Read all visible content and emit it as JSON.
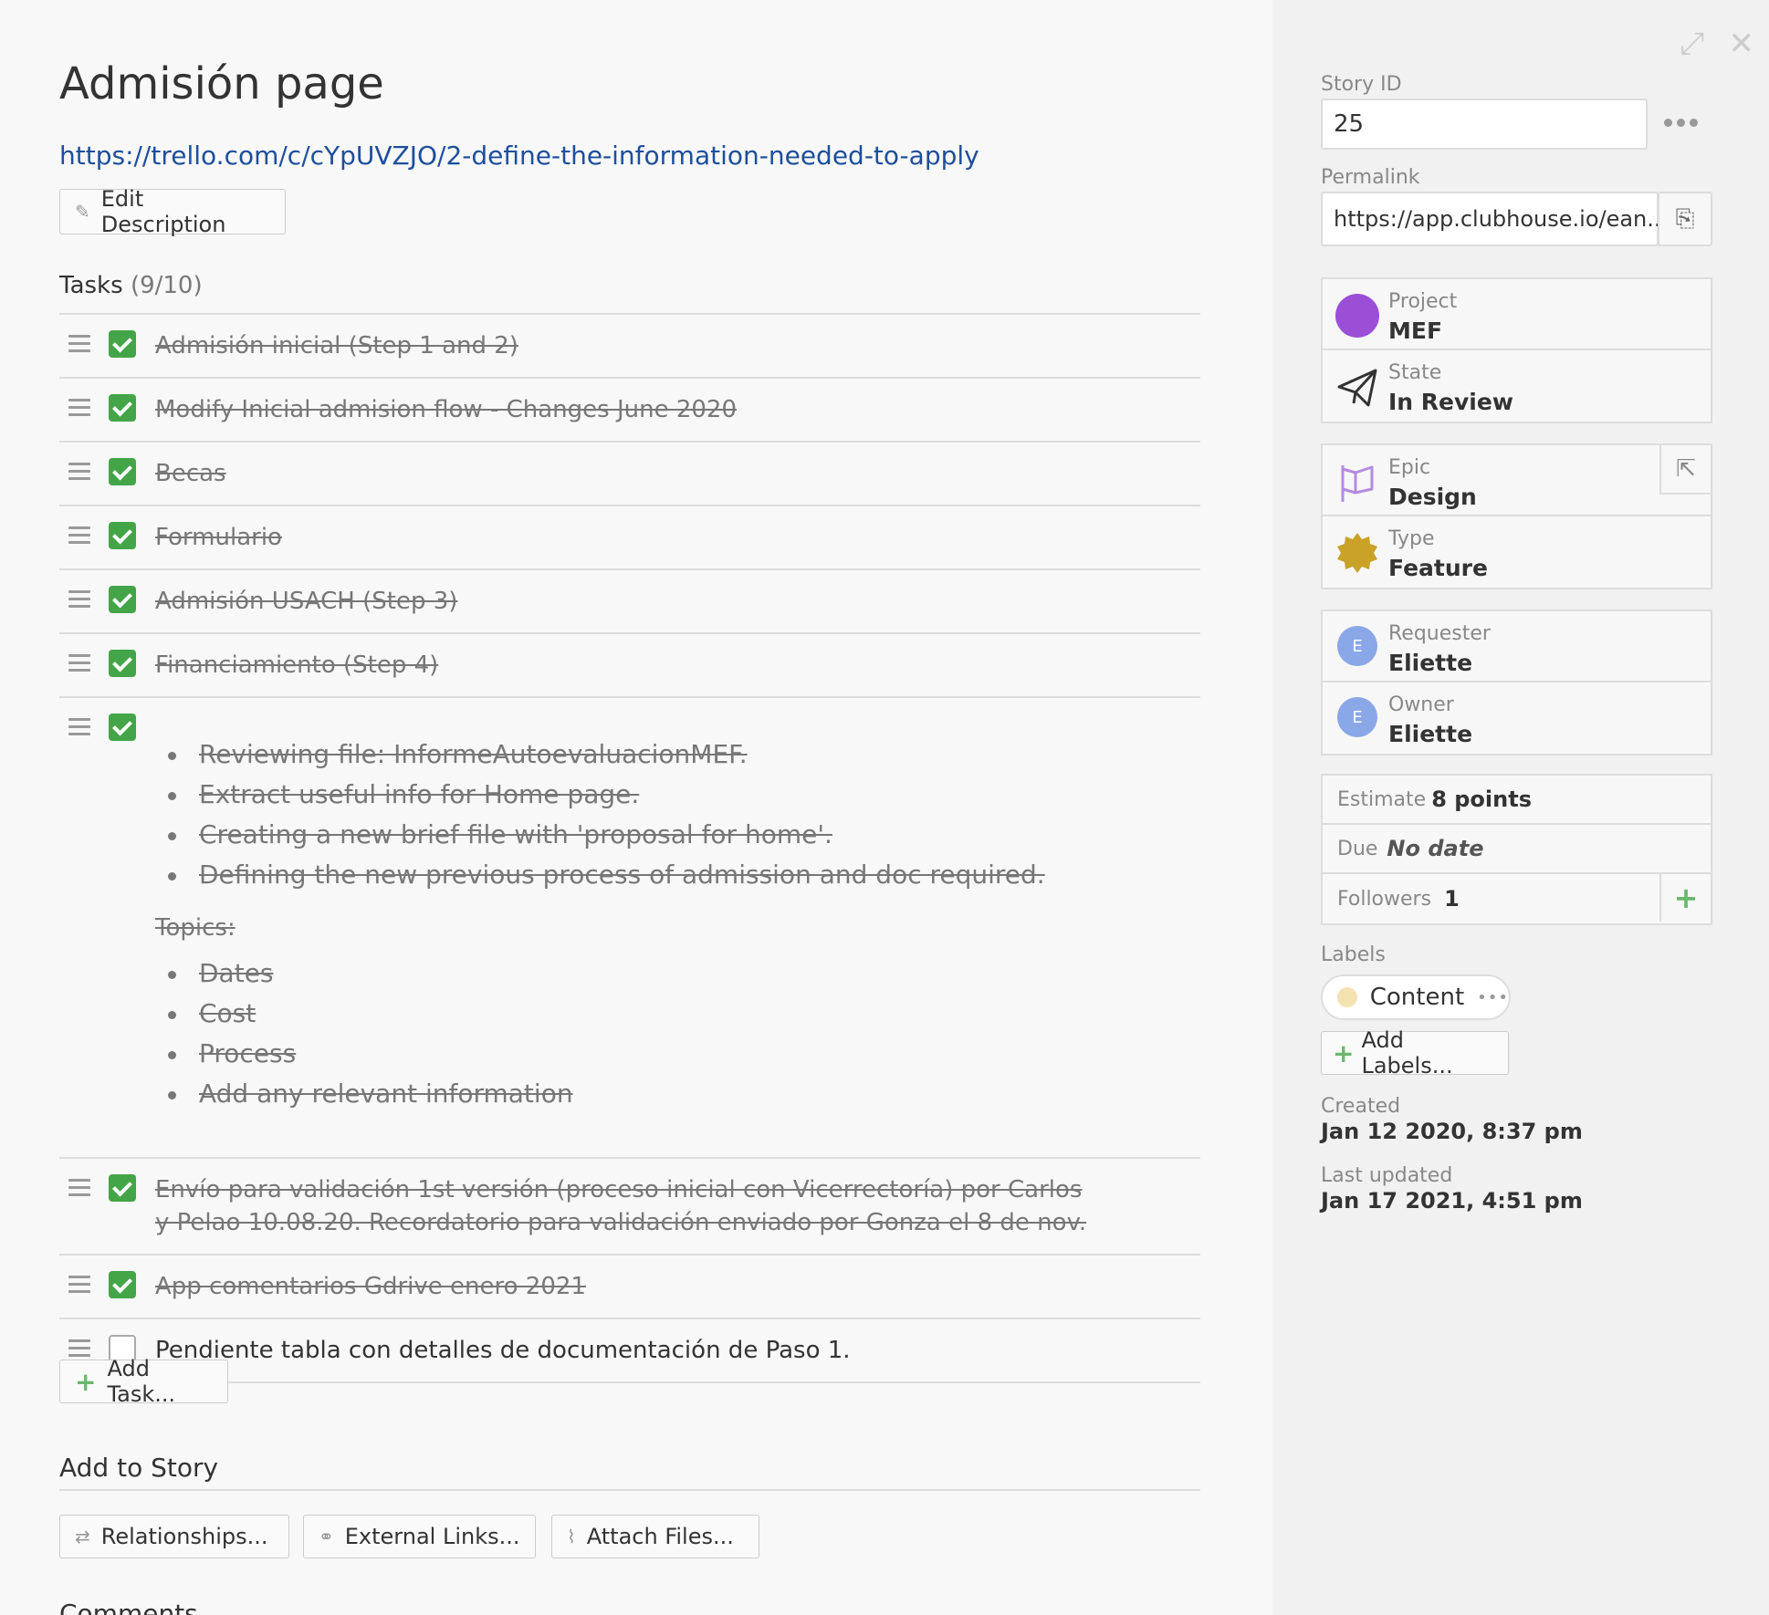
{
  "story": {
    "title": "Admisión page",
    "link": "https://trello.com/c/cYpUVZJO/2-define-the-information-needed-to-apply",
    "edit_description": "Edit Description"
  },
  "tasks": {
    "heading": "Tasks",
    "count": "(9/10)",
    "add_task": "Add Task...",
    "items": [
      {
        "text": "Admisión inicial (Step 1 and 2)",
        "done": true
      },
      {
        "text": "Modify Inicial admision flow - Changes June 2020",
        "done": true
      },
      {
        "text": "Becas",
        "done": true
      },
      {
        "text": "Formulario",
        "done": true
      },
      {
        "text": "Admisión USACH (Step 3)",
        "done": true
      },
      {
        "text": "Financiamiento (Step 4)",
        "done": true
      }
    ],
    "detail_task": {
      "bullets": [
        "Reviewing file: InformeAutoevaluacionMEF.",
        "Extract useful info for Home page.",
        "Creating a new brief file with 'proposal for home'.",
        "Defining the new previous process of admission and doc required."
      ],
      "topics_label": "Topics:",
      "topics": [
        "Dates",
        "Cost",
        "Process",
        "Add any relevant information"
      ]
    },
    "items2": [
      {
        "text": "Envío para validación 1st versión (proceso inicial con Vicerrectoría) por Carlos y Pelao 10.08.20. Recordatorio para validación enviado por Gonza el 8 de nov.",
        "done": true
      },
      {
        "text": "App comentarios Gdrive enero 2021",
        "done": true
      },
      {
        "text": "Pendiente tabla con detalles de documentación de Paso 1.",
        "done": false
      }
    ]
  },
  "add_to_story": {
    "heading": "Add to Story",
    "relationships": "Relationships...",
    "external_links": "External Links...",
    "attach_files": "Attach Files..."
  },
  "comments": {
    "heading": "Comments"
  },
  "sidebar": {
    "story_id_label": "Story ID",
    "story_id": "25",
    "permalink_label": "Permalink",
    "permalink": "https://app.clubhouse.io/ean...",
    "project_label": "Project",
    "project": "MEF",
    "project_color": "#9b4fd6",
    "state_label": "State",
    "state": "In Review",
    "epic_label": "Epic",
    "epic": "Design",
    "type_label": "Type",
    "type": "Feature",
    "type_color": "#c9a227",
    "requester_label": "Requester",
    "requester": "Eliette",
    "requester_initial": "E",
    "owner_label": "Owner",
    "owner": "Eliette",
    "owner_initial": "E",
    "estimate_label": "Estimate",
    "estimate": "8 points",
    "due_label": "Due",
    "due": "No date",
    "followers_label": "Followers",
    "followers": "1",
    "labels_label": "Labels",
    "label_content": "Content",
    "add_labels": "Add Labels...",
    "created_label": "Created",
    "created": "Jan 12 2020, 8:37 pm",
    "updated_label": "Last updated",
    "updated": "Jan 17 2021, 4:51 pm"
  }
}
